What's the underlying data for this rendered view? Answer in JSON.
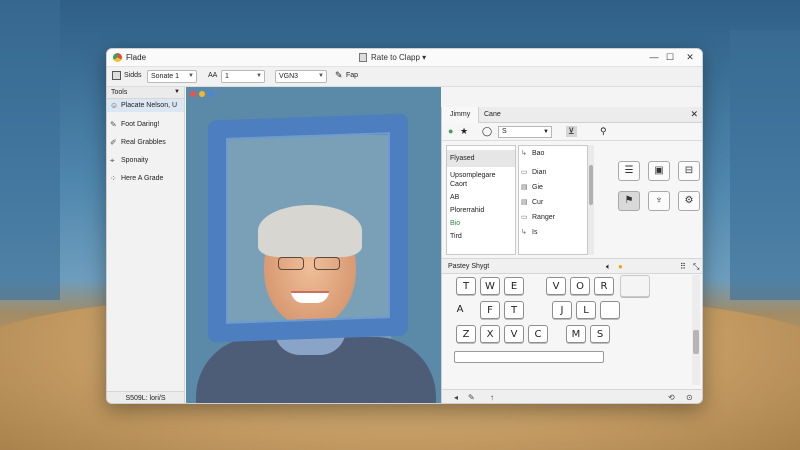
{
  "window": {
    "app_name": "Flade",
    "doc_title": "Rate to Clapp ▾",
    "minimize": "—",
    "maximize": "☐",
    "close": "✕"
  },
  "toolbar": {
    "font_label": "Sidds",
    "font_value": "Sonate 1",
    "size_label": "AA",
    "size_value": "1",
    "style_value": "VGN3",
    "flip_label": "Fap"
  },
  "left_panel": {
    "header": "Tools",
    "items": [
      {
        "label": "Placate Nelson, U",
        "icon": "person-icon"
      },
      {
        "label": "Foot Daring!",
        "icon": "pencil-icon"
      },
      {
        "label": "Real Grabbles",
        "icon": "brush-icon"
      },
      {
        "label": "Sponaity",
        "icon": "paint-icon"
      },
      {
        "label": "Here A Grade",
        "icon": "dots-icon"
      }
    ],
    "footer": "S509L: lori/S"
  },
  "right_panel": {
    "tabs": [
      "Jimmy",
      "Cane"
    ],
    "select_value": "S",
    "list_a": [
      "Flyased",
      "Upsomplegare Caort",
      "AB",
      "Plorerrahid",
      "Bio",
      "Tird"
    ],
    "list_b": [
      {
        "label": "Bao",
        "icon": "arrow-icon"
      },
      {
        "label": "Dian",
        "icon": "file-icon"
      },
      {
        "label": "Gie",
        "icon": "folder-icon"
      },
      {
        "label": "Cur",
        "icon": "folder-icon"
      },
      {
        "label": "Ranger",
        "icon": "file-icon"
      },
      {
        "label": "Is",
        "icon": "arrow-icon"
      }
    ],
    "keyboard_title": "Pastey Shygt",
    "keyboard_rows": [
      [
        "T",
        "W",
        "E",
        "V",
        "O",
        "R",
        ""
      ],
      [
        "A",
        "F",
        "T",
        "J",
        "L",
        ""
      ],
      [
        "Z",
        "X",
        "V",
        "C",
        "M",
        "S"
      ]
    ]
  },
  "colors": {
    "frame_blue": "#4d7fc0",
    "dot_red": "#e9534a",
    "dot_yellow": "#f2b632",
    "dot_blue": "#4a86d8"
  }
}
